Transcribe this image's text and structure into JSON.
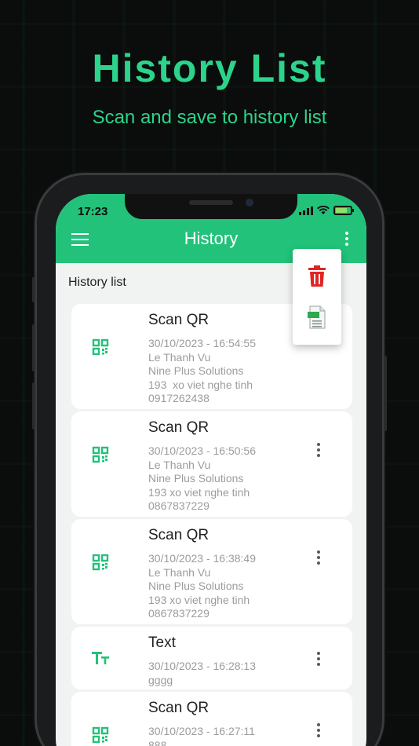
{
  "promo": {
    "headline": "History List",
    "subheadline": "Scan and save to history list"
  },
  "status_bar": {
    "time": "17:23"
  },
  "appbar": {
    "title": "History",
    "menu_icon": "hamburger-menu-icon",
    "more_icon": "more-vertical-icon"
  },
  "popup_menu": {
    "items": [
      {
        "icon": "trash-icon",
        "color": "#e02424"
      },
      {
        "icon": "csv-file-icon",
        "color": "#2fa84f"
      }
    ]
  },
  "list": {
    "heading": "History list",
    "items": [
      {
        "type": "Scan QR",
        "icon": "qr-code-icon",
        "date": "30/10/2023 - 16:54:55",
        "lines": [
          "Le Thanh Vu",
          "Nine Plus Solutions",
          "193  xo viet nghe tinh",
          "0917262438"
        ]
      },
      {
        "type": "Scan QR",
        "icon": "qr-code-icon",
        "date": "30/10/2023 - 16:50:56",
        "lines": [
          "Le Thanh Vu",
          "Nine Plus Solutions",
          "193 xo viet nghe tinh",
          "0867837229"
        ]
      },
      {
        "type": "Scan QR",
        "icon": "qr-code-icon",
        "date": "30/10/2023 - 16:38:49",
        "lines": [
          "Le Thanh Vu",
          "Nine Plus Solutions",
          "193 xo viet nghe tinh",
          "0867837229"
        ]
      },
      {
        "type": "Text",
        "icon": "text-type-icon",
        "date": "30/10/2023 - 16:28:13",
        "lines": [
          "gggg"
        ]
      },
      {
        "type": "Scan QR",
        "icon": "qr-code-icon",
        "date": "30/10/2023 - 16:27:11",
        "lines": [
          "888"
        ]
      }
    ]
  },
  "colors": {
    "accent": "#22c27a",
    "headline": "#2bd48a",
    "background": "#0b0c0c"
  }
}
